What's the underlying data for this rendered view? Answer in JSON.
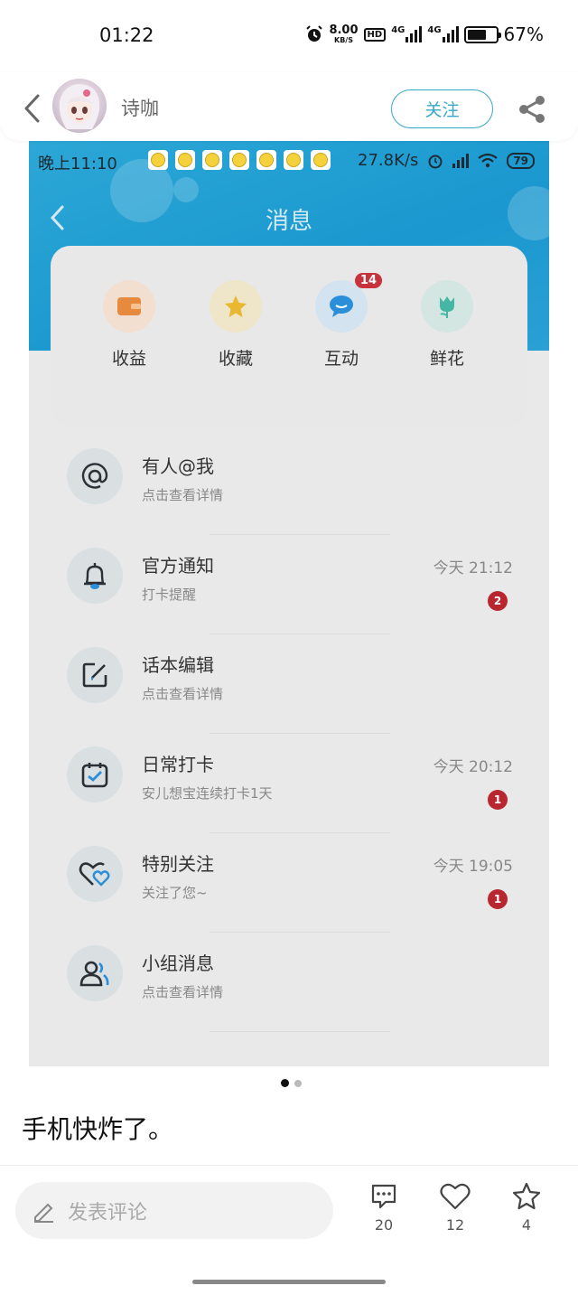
{
  "status_bar": {
    "time": "01:22",
    "net_speed_value": "8.00",
    "net_speed_unit": "KB/S",
    "hd_label": "HD",
    "sim1": "4G",
    "sim2": "4G",
    "battery_percent_text": "67%",
    "battery_level": 0.67
  },
  "post_header": {
    "author_name": "诗咖",
    "follow_label": "关注"
  },
  "embedded_screenshot": {
    "status": {
      "time": "晚上11:10",
      "net_speed": "27.8K/s",
      "battery": "79"
    },
    "nav_title": "消息",
    "quick_actions": [
      {
        "label": "收益",
        "icon": "wallet-icon",
        "color": "#e58a3f"
      },
      {
        "label": "收藏",
        "icon": "star-icon",
        "color": "#e8b830"
      },
      {
        "label": "互动",
        "icon": "chat-bubble-icon",
        "color": "#2a8fd8",
        "badge": "14"
      },
      {
        "label": "鲜花",
        "icon": "tulip-icon",
        "color": "#43b6a4"
      }
    ],
    "messages": [
      {
        "title": "有人@我",
        "subtitle": "点击查看详情",
        "time": "",
        "badge": "",
        "icon": "at-icon"
      },
      {
        "title": "官方通知",
        "subtitle": "打卡提醒",
        "time": "今天 21:12",
        "badge": "2",
        "icon": "bell-icon"
      },
      {
        "title": "话本编辑",
        "subtitle": "点击查看详情",
        "time": "",
        "badge": "",
        "icon": "edit-icon"
      },
      {
        "title": "日常打卡",
        "subtitle": "安儿想宝连续打卡1天",
        "time": "今天 20:12",
        "badge": "1",
        "icon": "calendar-check-icon"
      },
      {
        "title": "特别关注",
        "subtitle": "关注了您~",
        "time": "今天 19:05",
        "badge": "1",
        "icon": "hearts-icon"
      },
      {
        "title": "小组消息",
        "subtitle": "点击查看详情",
        "time": "",
        "badge": "",
        "icon": "group-icon"
      }
    ]
  },
  "carousel": {
    "page_count": 2,
    "active_index": 0
  },
  "caption": "手机快炸了。",
  "bottom_bar": {
    "comment_placeholder": "发表评论",
    "comments_count": "20",
    "likes_count": "12",
    "favorites_count": "4"
  },
  "colors": {
    "accent": "#39a7c7",
    "screenshot_header_blue": "#1a98cf",
    "badge_red": "#b8272f"
  }
}
